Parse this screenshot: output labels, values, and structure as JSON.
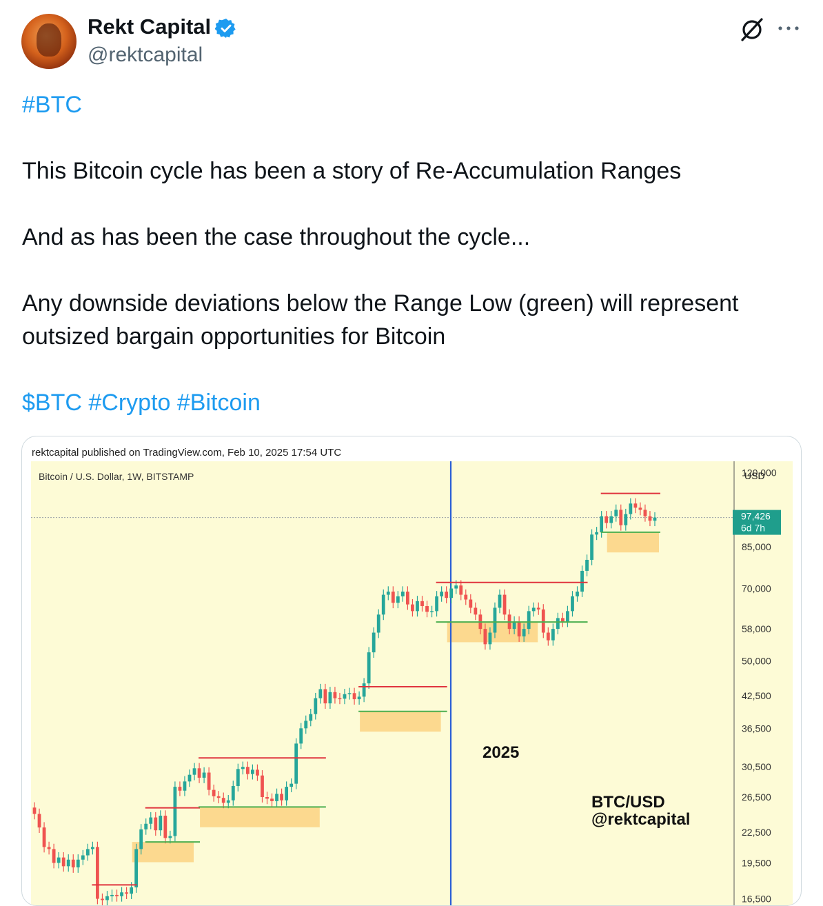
{
  "author": {
    "name": "Rekt Capital",
    "handle": "@rektcapital",
    "verified": true
  },
  "icons": {
    "verified": "verified-badge-icon",
    "grok": "grok-icon",
    "more": "more-options-icon",
    "avatar": "avatar"
  },
  "tweet": {
    "hashtag_top": "#BTC",
    "line1": "This Bitcoin cycle has been a story of Re-Accumulation Ranges",
    "line2": "And as has been the case throughout the cycle...",
    "line3a": "Any downside deviations below the Range Low (green) will represent",
    "line3b": "outsized bargain opportunities for Bitcoin",
    "tags": [
      "$BTC",
      "#Crypto",
      "#Bitcoin"
    ]
  },
  "colors": {
    "link": "#1d9bf0",
    "chart_bg": "#fdfbd6",
    "range_high": "#e0343e",
    "range_low": "#4caf50",
    "zone": "#fcd98f",
    "bull": "#26a69a",
    "bear": "#ef5350",
    "divider": "#2a5ed6"
  },
  "chart": {
    "published": "rektcapital published on TradingView.com, Feb 10, 2025 17:54 UTC",
    "symbol": "Bitcoin / U.S. Dollar, 1W, BITSTAMP",
    "currency": "USD",
    "year_label": "2025",
    "watermark_line1": "BTC/USD",
    "watermark_line2": "@rektcapital",
    "last_price": "97,426",
    "countdown": "6d 7h"
  },
  "chart_data": {
    "type": "candlestick",
    "title": "Bitcoin / U.S. Dollar, 1W, BITSTAMP",
    "y_scale": "log",
    "y_ticks": [
      120000,
      85000,
      70000,
      58000,
      50000,
      42500,
      36500,
      30500,
      26500,
      22500,
      19500,
      16500
    ],
    "y_tick_labels": [
      "120,000",
      "85,000",
      "70,000",
      "58,000",
      "50,000",
      "42,500",
      "36,500",
      "30,500",
      "26,500",
      "22,500",
      "19,500",
      "16,500"
    ],
    "ylim": [
      15500,
      125000
    ],
    "last_price": 97426,
    "ranges": [
      {
        "high": 17600,
        "low": 15900
      },
      {
        "high": 25200,
        "low": 21500
      },
      {
        "high": 31800,
        "low": 25300
      },
      {
        "high": 44300,
        "low": 39500
      },
      {
        "high": 72000,
        "low": 59900
      },
      {
        "high": 109000,
        "low": 91000
      }
    ],
    "closes": [
      24500,
      23000,
      21000,
      20800,
      19500,
      20000,
      19200,
      19800,
      19100,
      19800,
      20200,
      20800,
      21000,
      16500,
      16400,
      16700,
      16800,
      16700,
      17000,
      16900,
      17400,
      20800,
      22800,
      23400,
      24100,
      22700,
      24300,
      21900,
      22100,
      27800,
      27300,
      28500,
      29400,
      30300,
      29000,
      29700,
      27400,
      26600,
      26400,
      25800,
      26100,
      27900,
      30200,
      30500,
      29500,
      30100,
      29300,
      26500,
      26300,
      26000,
      26900,
      26100,
      27800,
      28200,
      34000,
      36500,
      37800,
      39000,
      42000,
      43800,
      41000,
      43200,
      42000,
      41900,
      42800,
      43000,
      41800,
      42300,
      45000,
      52000,
      57000,
      62000,
      68000,
      69000,
      65500,
      67500,
      69000,
      65000,
      63000,
      66000,
      64500,
      62800,
      63000,
      67500,
      69000,
      67000,
      70000,
      71000,
      68000,
      66500,
      64000,
      62000,
      58000,
      54000,
      57000,
      64000,
      68000,
      62000,
      58000,
      60000,
      56000,
      58000,
      63000,
      64000,
      63500,
      57000,
      55000,
      58000,
      61000,
      60000,
      63000,
      67500,
      69000,
      76000,
      80000,
      90000,
      91000,
      98000,
      95000,
      98000,
      101000,
      94000,
      99000,
      104000,
      102000,
      101000,
      98000,
      96000,
      97426
    ]
  }
}
